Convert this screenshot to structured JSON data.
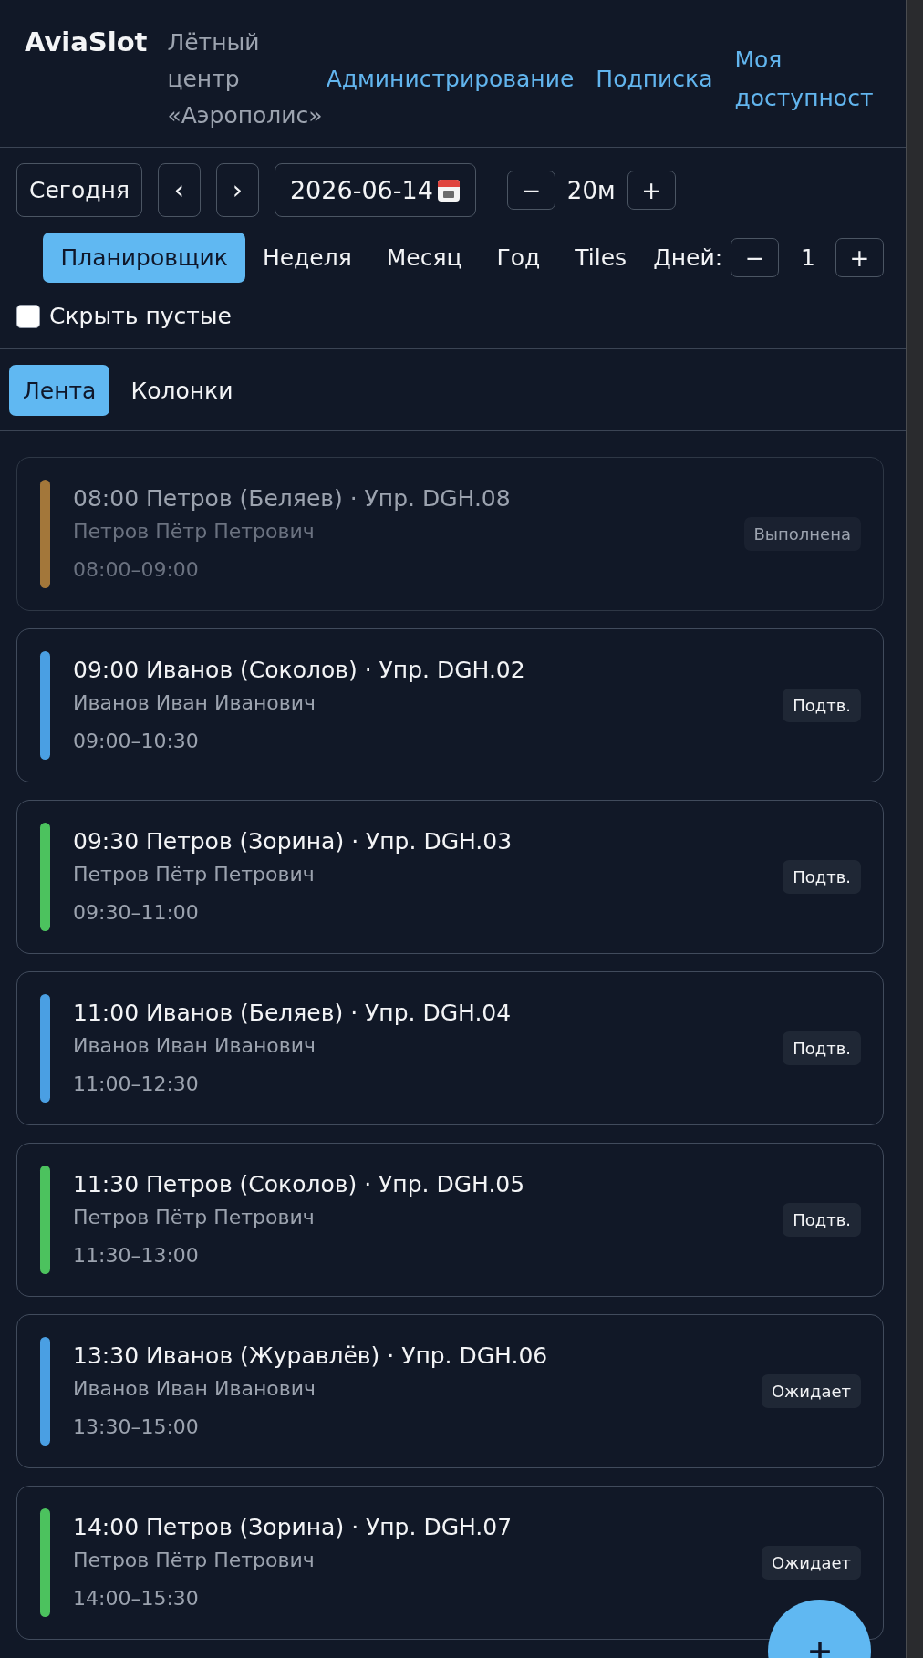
{
  "header": {
    "logo": "AviaSlot",
    "organization": "Лётный центр «Аэрополис»",
    "nav_links": [
      "Администрирование",
      "Подписка",
      "Моя доступност"
    ]
  },
  "toolbar": {
    "today_button": "Сегодня",
    "prev_button": "‹",
    "next_button": "›",
    "date": "2026-06-14",
    "zoom": {
      "minus": "−",
      "value": "20м",
      "plus": "+"
    }
  },
  "views": [
    {
      "label": "Планировщик",
      "selected": true
    },
    {
      "label": "Неделя",
      "selected": false
    },
    {
      "label": "Месяц",
      "selected": false
    },
    {
      "label": "Год",
      "selected": false
    },
    {
      "label": "Tiles",
      "selected": false
    }
  ],
  "days": {
    "label": "Дней:",
    "minus": "−",
    "value": "1",
    "plus": "+"
  },
  "hide_empty": {
    "label": "Скрыть пустые",
    "checked": false
  },
  "layout_tabs": [
    {
      "label": "Лента",
      "selected": true
    },
    {
      "label": "Колонки",
      "selected": false
    }
  ],
  "bookings": [
    {
      "title": "08:00 Петров (Беляев) · Упр. DGH.08",
      "person": "Петров Пётр Петрович",
      "time": "08:00–09:00",
      "status": "Выполнена",
      "color": "#a3773a",
      "dimmed": true
    },
    {
      "title": "09:00 Иванов (Соколов) · Упр. DGH.02",
      "person": "Иванов Иван Иванович",
      "time": "09:00–10:30",
      "status": "Подтв.",
      "color": "#4a9fe3",
      "dimmed": false
    },
    {
      "title": "09:30 Петров (Зорина) · Упр. DGH.03",
      "person": "Петров Пётр Петрович",
      "time": "09:30–11:00",
      "status": "Подтв.",
      "color": "#4cc25e",
      "dimmed": false
    },
    {
      "title": "11:00 Иванов (Беляев) · Упр. DGH.04",
      "person": "Иванов Иван Иванович",
      "time": "11:00–12:30",
      "status": "Подтв.",
      "color": "#4a9fe3",
      "dimmed": false
    },
    {
      "title": "11:30 Петров (Соколов) · Упр. DGH.05",
      "person": "Петров Пётр Петрович",
      "time": "11:30–13:00",
      "status": "Подтв.",
      "color": "#4cc25e",
      "dimmed": false
    },
    {
      "title": "13:30 Иванов (Журавлёв) · Упр. DGH.06",
      "person": "Иванов Иван Иванович",
      "time": "13:30–15:00",
      "status": "Ожидает",
      "color": "#4a9fe3",
      "dimmed": false
    },
    {
      "title": "14:00 Петров (Зорина) · Упр. DGH.07",
      "person": "Петров Пётр Петрович",
      "time": "14:00–15:30",
      "status": "Ожидает",
      "color": "#4cc25e",
      "dimmed": false
    }
  ]
}
